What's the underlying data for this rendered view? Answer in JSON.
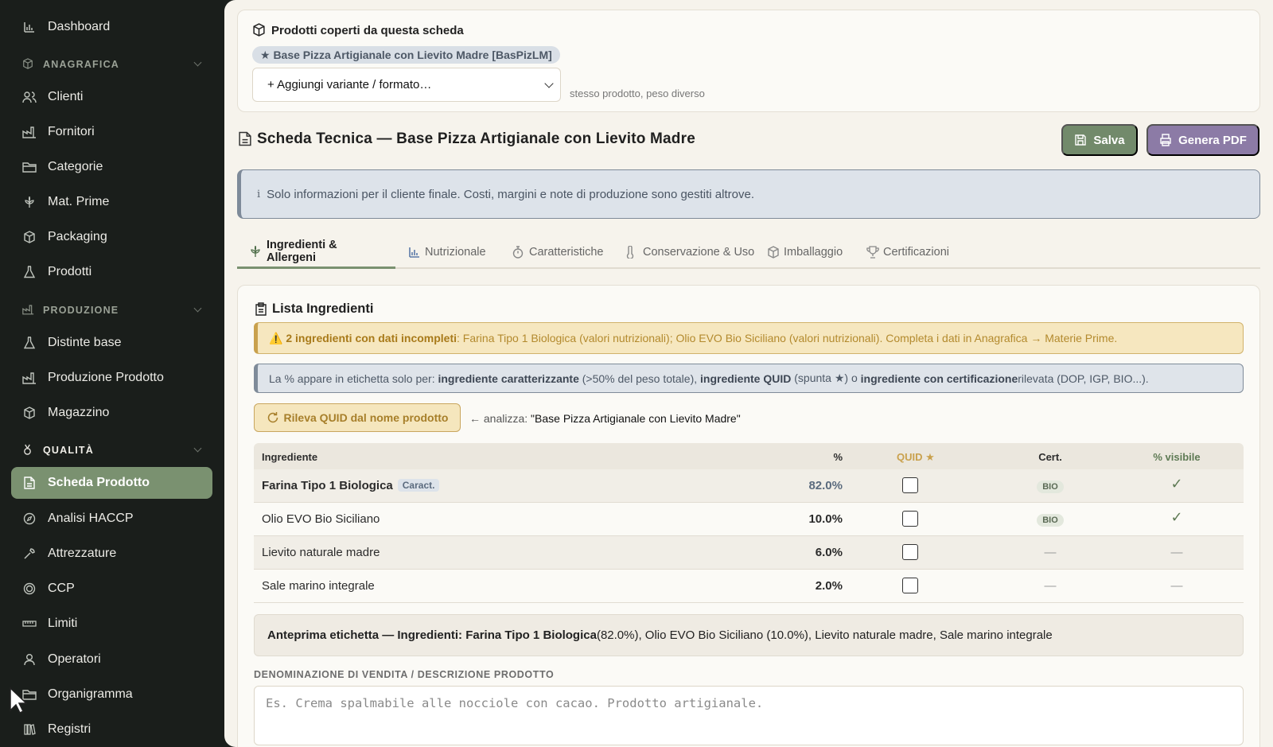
{
  "sidebar": {
    "items": [
      {
        "label": "Dashboard",
        "icon": "bar-chart-icon"
      },
      {
        "label": "Clienti",
        "icon": "users-icon"
      },
      {
        "label": "Fornitori",
        "icon": "factory-icon"
      },
      {
        "label": "Categorie",
        "icon": "folder-icon"
      },
      {
        "label": "Mat. Prime",
        "icon": "wheat-icon"
      },
      {
        "label": "Packaging",
        "icon": "box-icon"
      },
      {
        "label": "Prodotti",
        "icon": "flask-icon"
      },
      {
        "label": "Distinte base",
        "icon": "flask-icon"
      },
      {
        "label": "Produzione Prodotto",
        "icon": "factory-icon"
      },
      {
        "label": "Magazzino",
        "icon": "box-icon"
      },
      {
        "label": "Scheda Prodotto",
        "icon": "document-icon"
      },
      {
        "label": "Analisi HACCP",
        "icon": "compass-icon"
      },
      {
        "label": "Attrezzature",
        "icon": "wrench-icon"
      },
      {
        "label": "CCP",
        "icon": "target-icon"
      },
      {
        "label": "Limiti",
        "icon": "ruler-icon"
      },
      {
        "label": "Operatori",
        "icon": "user-icon"
      },
      {
        "label": "Organigramma",
        "icon": "folder-icon"
      },
      {
        "label": "Registri",
        "icon": "books-icon"
      }
    ],
    "sections": {
      "anagrafica": "ANAGRAFICA",
      "produzione": "PRODUZIONE",
      "qualita": "QUALITÀ"
    }
  },
  "products": {
    "title": "Prodotti coperti da questa scheda",
    "chip": "★ Base Pizza Artigianale con Lievito Madre [BasPizLM]",
    "select_value": "+ Aggiungi variante / formato…",
    "select_hint": "stesso prodotto, peso diverso"
  },
  "page": {
    "title": "Scheda Tecnica — Base Pizza Artigianale con Lievito Madre",
    "save_label": "Salva",
    "pdf_label": "Genera PDF",
    "info": "Solo informazioni per il cliente finale. Costi, margini e note di produzione sono gestiti altrove.",
    "info_icon": "i"
  },
  "tabs": [
    {
      "label": "Ingredienti & Allergeni",
      "icon": "wheat-icon"
    },
    {
      "label": "Nutrizionale",
      "icon": "bar-chart-icon"
    },
    {
      "label": "Caratteristiche",
      "icon": "stopwatch-icon"
    },
    {
      "label": "Conservazione & Uso",
      "icon": "thermometer-icon"
    },
    {
      "label": "Imballaggio",
      "icon": "box-icon"
    },
    {
      "label": "Certificazioni",
      "icon": "trophy-icon"
    }
  ],
  "ingredients": {
    "title": "Lista Ingredienti",
    "warning_bold": "⚠️ 2 ingredienti con dati incompleti",
    "warning_rest": ": Farina Tipo 1 Biologica (valori nutrizionali); Olio EVO Bio Siciliano (valori nutrizionali). Completa i dati in Anagrafica → Materie Prime.",
    "note": {
      "p1": "La % appare in etichetta solo per: ",
      "b1": "ingrediente caratterizzante",
      "p2": " (>50% del peso totale), ",
      "b2": "ingrediente QUID",
      "p3": " (spunta ★) o ",
      "b3": "ingrediente con certificazione",
      "p4": " rilevata (DOP, IGP, BIO...)."
    },
    "quid_button": "Rileva QUID dal nome prodotto",
    "analizza_label": "← analizza: ",
    "analizza_value": "\"Base Pizza Artigianale con Lievito Madre\"",
    "columns": {
      "name": "Ingrediente",
      "pct": "%",
      "quid": "QUID ★",
      "cert": "Cert.",
      "visible": "% visibile"
    },
    "rows": [
      {
        "name": "Farina Tipo 1 Biologica",
        "badge": "Caract.",
        "pct": "82.0%",
        "cert": "BIO",
        "visible": "✓"
      },
      {
        "name": "Olio EVO Bio Siciliano",
        "badge": "",
        "pct": "10.0%",
        "cert": "BIO",
        "visible": "✓"
      },
      {
        "name": "Lievito naturale madre",
        "badge": "",
        "pct": "6.0%",
        "cert": "—",
        "visible": "—"
      },
      {
        "name": "Sale marino integrale",
        "badge": "",
        "pct": "2.0%",
        "cert": "—",
        "visible": "—"
      }
    ],
    "preview_bold": "Anteprima etichetta — Ingredienti: Farina Tipo 1 Biologica",
    "preview_rest": " (82.0%), Olio EVO Bio Siciliano (10.0%), Lievito naturale madre, Sale marino integrale",
    "desc_label": "DENOMINAZIONE DI VENDITA / DESCRIZIONE PRODOTTO",
    "desc_placeholder": "Es. Crema spalmabile alle nocciole con cacao. Prodotto artigianale."
  },
  "colors": {
    "sidebar_bg": "#1a1e1b",
    "active_nav": "#7a9170",
    "save_button": "#728a6b",
    "pdf_button": "#8c7ba6",
    "warning": "#c9a14d"
  }
}
